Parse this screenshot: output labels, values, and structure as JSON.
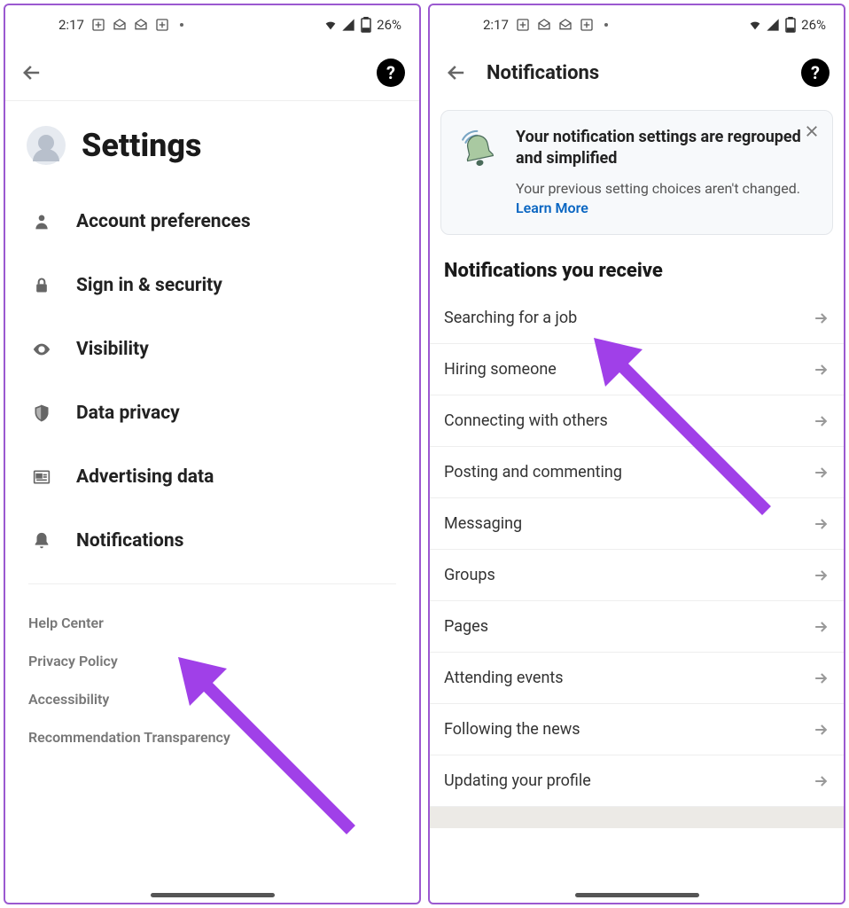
{
  "status": {
    "time": "2:17",
    "battery": "26%"
  },
  "screen1": {
    "title": "Settings",
    "items": [
      {
        "label": "Account preferences"
      },
      {
        "label": "Sign in & security"
      },
      {
        "label": "Visibility"
      },
      {
        "label": "Data privacy"
      },
      {
        "label": "Advertising data"
      },
      {
        "label": "Notifications"
      }
    ],
    "footer": [
      "Help Center",
      "Privacy Policy",
      "Accessibility",
      "Recommendation Transparency"
    ]
  },
  "screen2": {
    "header_title": "Notifications",
    "banner": {
      "title": "Your notification settings are regrouped and simplified",
      "subtitle": "Your previous setting choices aren't changed.",
      "learn_more": "Learn More"
    },
    "section_title": "Notifications you receive",
    "items": [
      "Searching for a job",
      "Hiring someone",
      "Connecting with others",
      "Posting and commenting",
      "Messaging",
      "Groups",
      "Pages",
      "Attending events",
      "Following the news",
      "Updating your profile"
    ]
  }
}
